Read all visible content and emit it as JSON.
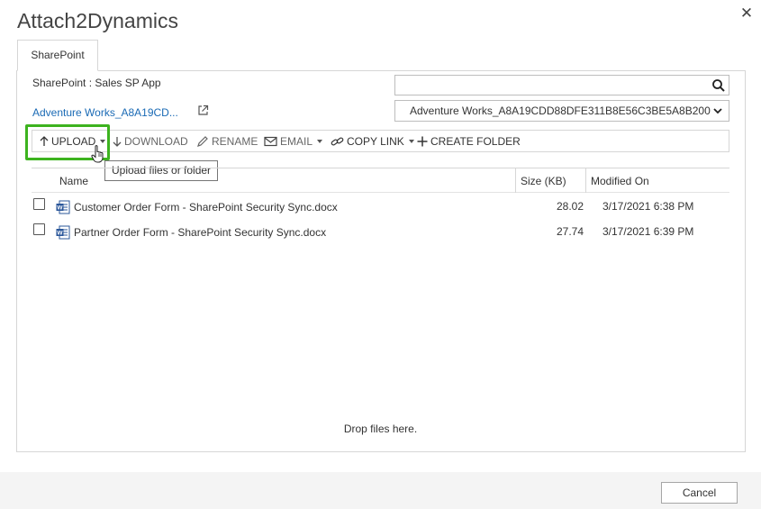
{
  "app": {
    "title": "Attach2Dynamics"
  },
  "tabs": [
    {
      "label": "SharePoint"
    }
  ],
  "location": {
    "site_label": "SharePoint : Sales SP App",
    "folder_link": "Adventure Works_A8A19CD...",
    "folder_select_value": "Adventure Works_A8A19CDD88DFE311B8E56C3BE5A8B200",
    "search_value": ""
  },
  "toolbar": {
    "upload": "UPLOAD",
    "download": "DOWNLOAD",
    "rename": "RENAME",
    "email": "EMAIL",
    "copy_link": "COPY LINK",
    "create_folder": "CREATE FOLDER"
  },
  "tooltip": "Upload files or folder",
  "grid": {
    "columns": {
      "name": "Name",
      "size": "Size (KB)",
      "modified": "Modified On"
    },
    "rows": [
      {
        "name": "Customer Order Form - SharePoint Security Sync.docx",
        "size": "28.02",
        "modified": "3/17/2021 6:38 PM",
        "icon": "word-doc-icon"
      },
      {
        "name": "Partner Order Form - SharePoint Security Sync.docx",
        "size": "27.74",
        "modified": "3/17/2021 6:39 PM",
        "icon": "word-doc-icon"
      }
    ]
  },
  "drop_zone_text": "Drop files here.",
  "footer": {
    "cancel_label": "Cancel"
  },
  "colors": {
    "accent_link": "#1a6ab5",
    "highlight": "#3db31f",
    "border": "#d6d6d6"
  }
}
